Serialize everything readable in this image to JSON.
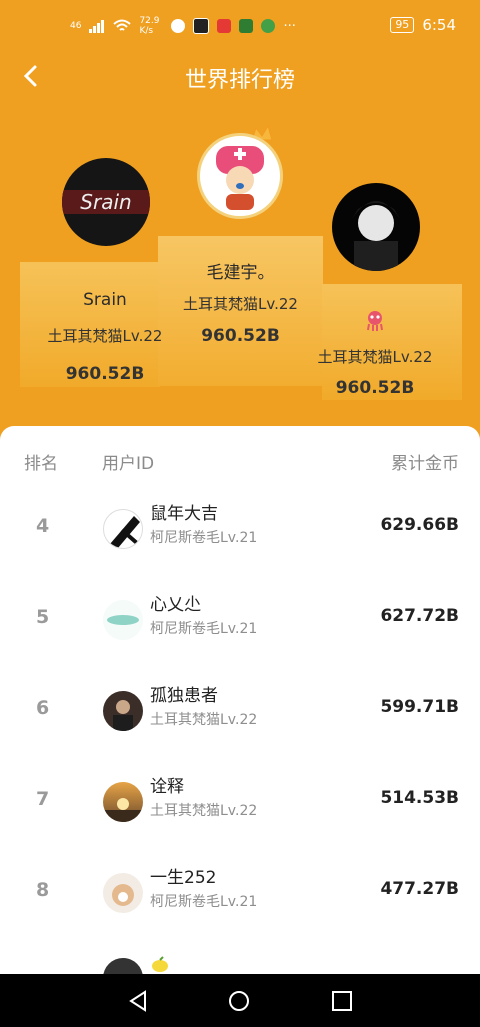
{
  "status": {
    "network": "46",
    "speed": "72.9 K/s",
    "battery": "95",
    "time": "6:54"
  },
  "title": "世界排行榜",
  "podium": [
    {
      "name": "Srain",
      "level": "土耳其梵猫Lv.22",
      "coins": "960.52B",
      "avatar_text": "Srain"
    },
    {
      "name": "毛建宇。",
      "level": "土耳其梵猫Lv.22",
      "coins": "960.52B"
    },
    {
      "name": "",
      "level": "土耳其梵猫Lv.22",
      "coins": "960.52B"
    }
  ],
  "table": {
    "headers": {
      "rank": "排名",
      "user": "用户ID",
      "coins": "累计金币"
    },
    "rows": [
      {
        "rank": "4",
        "name": "鼠年大吉",
        "level": "柯尼斯卷毛Lv.21",
        "coins": "629.66B"
      },
      {
        "rank": "5",
        "name": "心乂尐",
        "level": "柯尼斯卷毛Lv.21",
        "coins": "627.72B"
      },
      {
        "rank": "6",
        "name": "孤独患者",
        "level": "土耳其梵猫Lv.22",
        "coins": "599.71B"
      },
      {
        "rank": "7",
        "name": "诠释",
        "level": "土耳其梵猫Lv.22",
        "coins": "514.53B"
      },
      {
        "rank": "8",
        "name": "一生252",
        "level": "柯尼斯卷毛Lv.21",
        "coins": "477.27B"
      }
    ]
  }
}
